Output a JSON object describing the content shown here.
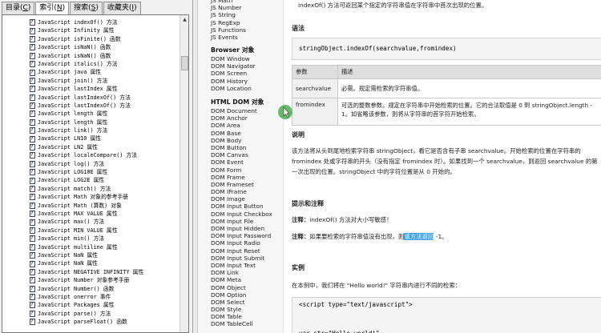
{
  "tabs": [
    {
      "label": "目录",
      "key": "C"
    },
    {
      "label": "索引",
      "key": "N"
    },
    {
      "label": "搜索",
      "key": "S"
    },
    {
      "label": "收藏夹",
      "key": "I"
    }
  ],
  "index_items": [
    "JavaScript indexOf() 方法",
    "JavaScript Infinity 属性",
    "JavaScript isFinite() 函数",
    "JavaScript isNaN() 函数",
    "JavaScript isNaN() 函数",
    "JavaScript italics() 方法",
    "JavaScript java 属性",
    "JavaScript join() 方法",
    "JavaScript lastIndex 属性",
    "JavaScript lastIndexOf() 方法",
    "JavaScript lastIndexOf() 方法",
    "JavaScript length 属性",
    "JavaScript length 属性",
    "JavaScript link() 方法",
    "JavaScript LN10 属性",
    "JavaScript LN2 属性",
    "JavaScript localeCompare() 方法",
    "JavaScript log() 方法",
    "JavaScript LOG10E 属性",
    "JavaScript LOG2E 属性",
    "JavaScript match() 方法",
    "JavaScript Math 对象的参考手册",
    "JavaScript Math (算数) 对象",
    "JavaScript MAX VALUE 属性",
    "JavaScript max() 方法",
    "JavaScript MIN VALUE 属性",
    "JavaScript min() 方法",
    "JavaScript multiline 属性",
    "JavaScript NaN 属性",
    "JavaScript NaN 属性",
    "JavaScript NEGATIVE INFINITY 属性",
    "JavaScript Number 对象参考手册",
    "JavaScript Number() 函数",
    "JavaScript onerror 事件",
    "JavaScript Packages 属性",
    "JavaScript parse() 方法",
    "JavaScript parseFloat() 函数"
  ],
  "nav": {
    "js_links": [
      "JS Math",
      "JS Number",
      "JS String",
      "JS RegExp",
      "JS Functions",
      "JS Events"
    ],
    "browser_heading": "Browser 对象",
    "browser_links": [
      "DOM Window",
      "DOM Navigator",
      "DOM Screen",
      "DOM History",
      "DOM Location"
    ],
    "htmldom_heading": "HTML DOM 对象",
    "htmldom_links": [
      "DOM Document",
      "DOM Anchor",
      "DOM Area",
      "DOM Base",
      "DOM Body",
      "DOM Button",
      "DOM Canvas",
      "DOM Event",
      "DOM Form",
      "DOM Frame",
      "DOM Frameset",
      "DOM IFrame",
      "DOM Image",
      "DOM Input Button",
      "DOM Input Checkbox",
      "DOM Input File",
      "DOM Input Hidden",
      "DOM Input Password",
      "DOM Input Radio",
      "DOM Input Reset",
      "DOM Input Submit",
      "DOM Input Text",
      "DOM Link",
      "DOM Meta",
      "DOM Object",
      "DOM Option",
      "DOM Select",
      "DOM Style",
      "DOM Table",
      "DOM TableCell"
    ]
  },
  "content": {
    "intro": "indexOf() 方法可返回某个指定的字符串值在字符串中首次出现的位置。",
    "syntax_title": "语法",
    "syntax_code": "stringObject.indexOf(searchvalue,fromindex)",
    "table_header": [
      "参数",
      "描述"
    ],
    "table_rows": [
      {
        "name": "searchvalue",
        "desc": "必需。规定需检索的字符串值。"
      },
      {
        "name": "fromindex",
        "desc": "可选的整数参数。规定在字符串中开始检索的位置。它的合法取值是 0 到 stringObject.length - 1。如省略该参数，则将从字符串的首字符开始检索。"
      }
    ],
    "desc_title": "说明",
    "desc_text": "该方法将从头到尾地检索字符串 stringObject，看它是否含有子串 searchvalue。开始检索的位置在字符串的 fromindex 处或字符串的开头（没有指定 fromindex 时）。如果找到一个 searchvalue，则返回 searchvalue 的第一次出现的位置。stringObject 中的字符位置是从 0 开始的。",
    "tips_title": "提示和注释",
    "note1_label": "注释：",
    "note1_text": "indexOf() 方法对大小写敏感！",
    "note2_label": "注释：",
    "note2_pre": "如果要检索的字符串值没有出现，则",
    "note2_highlight": "该方法返回",
    "note2_post": " -1。",
    "example_title": "实例",
    "example_intro": "在本例中，我们将在 \"Hello world!\" 字符串内进行不同的检索：",
    "code_lines": [
      "<script type=\"text/javascript\">",
      "",
      "var str=\"Hello world!\""
    ]
  }
}
